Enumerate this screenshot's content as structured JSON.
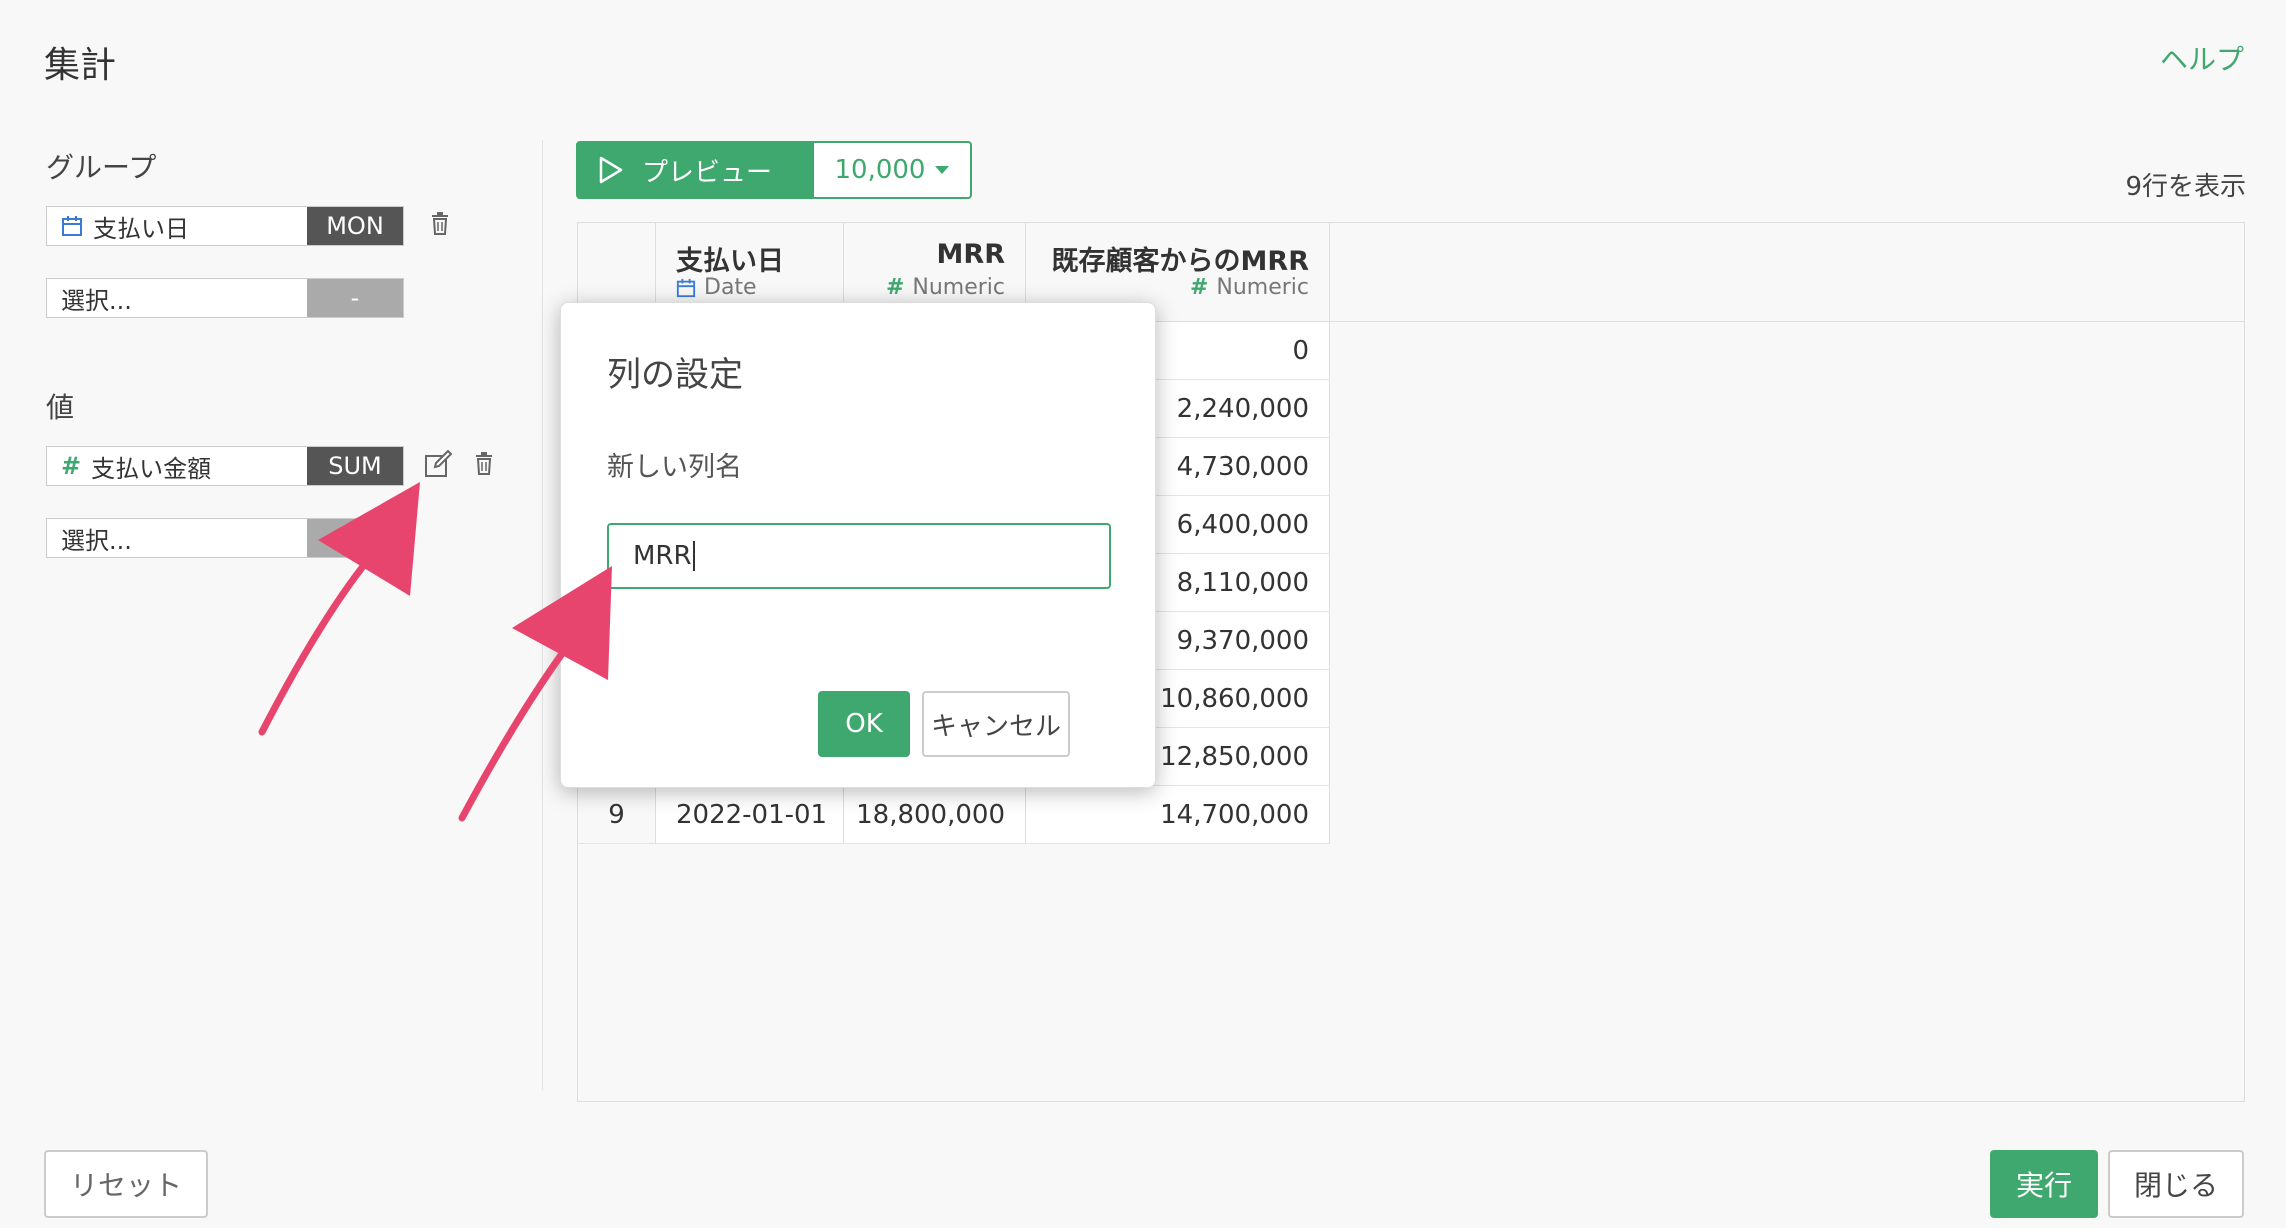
{
  "header": {
    "title": "集計",
    "help": "ヘルプ"
  },
  "sidebar": {
    "group_label": "グループ",
    "group_field": {
      "name": "支払い日",
      "func": "MON"
    },
    "group_select": {
      "placeholder": "選択...",
      "func": "-"
    },
    "value_label": "値",
    "value_field": {
      "name": "支払い金額",
      "func": "SUM",
      "icon": "#"
    },
    "value_select": {
      "placeholder": "選択..."
    }
  },
  "toolbar": {
    "preview_label": "プレビュー",
    "limit": "10,000",
    "row_count": "9行を表示"
  },
  "table": {
    "columns": [
      {
        "name": "支払い日",
        "type": "Date"
      },
      {
        "name": "MRR",
        "type": "Numeric",
        "type_icon": "#"
      },
      {
        "name": "既存顧客からのMRR",
        "type": "Numeric",
        "type_icon": "#"
      }
    ],
    "rows": [
      {
        "idx": "",
        "date": "",
        "mrr": "",
        "existing": "0"
      },
      {
        "idx": "",
        "date": "",
        "mrr": "",
        "existing": "2,240,000"
      },
      {
        "idx": "",
        "date": "",
        "mrr": "",
        "existing": "4,730,000"
      },
      {
        "idx": "",
        "date": "",
        "mrr": "",
        "existing": "6,400,000"
      },
      {
        "idx": "",
        "date": "",
        "mrr": "",
        "existing": "8,110,000"
      },
      {
        "idx": "",
        "date": "",
        "mrr": "",
        "existing": "9,370,000"
      },
      {
        "idx": "",
        "date": "",
        "mrr": "",
        "existing": "10,860,000"
      },
      {
        "idx": "",
        "date": "",
        "mrr": "",
        "existing": "12,850,000"
      },
      {
        "idx": "9",
        "date": "2022-01-01",
        "mrr": "18,800,000",
        "existing": "14,700,000"
      }
    ]
  },
  "modal": {
    "title": "列の設定",
    "label": "新しい列名",
    "input_value": "MRR",
    "ok": "OK",
    "cancel": "キャンセル"
  },
  "footer": {
    "reset": "リセット",
    "run": "実行",
    "close": "閉じる"
  },
  "colors": {
    "accent": "#3fa86e",
    "arrow": "#e8456e",
    "date_icon": "#3a7bd5"
  }
}
